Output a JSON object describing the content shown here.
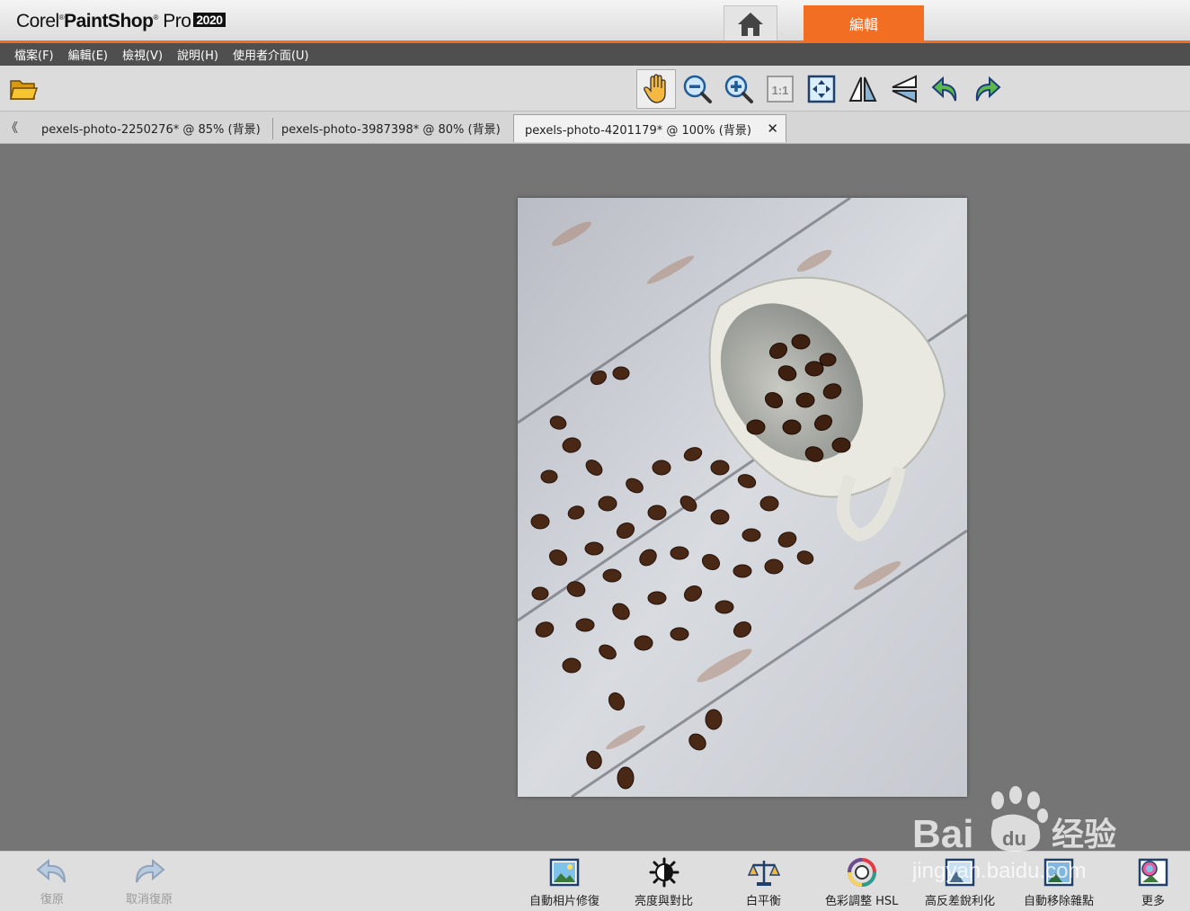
{
  "app": {
    "brand_corel": "Corel",
    "brand_paintshop": "PaintShop",
    "brand_pro": "Pro",
    "brand_version": "2020",
    "accent_color": "#f26e22"
  },
  "workspace_tabs": {
    "home_icon": "home-icon",
    "edit_label": "編輯"
  },
  "menu": [
    "檔案(F)",
    "編輯(E)",
    "檢視(V)",
    "說明(H)",
    "使用者介面(U)"
  ],
  "toolbar": {
    "tools": [
      "open-folder-icon",
      "pan-hand-icon",
      "zoom-out-icon",
      "zoom-in-icon",
      "actual-size-icon",
      "fit-window-icon",
      "flip-icon",
      "mirror-icon",
      "rotate-left-icon",
      "rotate-right-icon"
    ],
    "actual_size_label": "1:1"
  },
  "doc_tabs": [
    {
      "label": "pexels-photo-2250276* @  85% (背景)"
    },
    {
      "label": "pexels-photo-3987398* @  80% (背景)"
    },
    {
      "label": "pexels-photo-4201179* @ 100% (背景)",
      "active": true
    }
  ],
  "tab_scroll_glyph": "《",
  "tab_close_glyph": "✕",
  "bottom": {
    "undo": "復原",
    "redo": "取消復原",
    "tools": [
      "自動相片修復",
      "亮度與對比",
      "白平衡",
      "色彩調整 HSL",
      "高反差銳利化",
      "自動移除雜點",
      "更多"
    ]
  },
  "watermark": {
    "brand": "Bai",
    "du": "du",
    "jingyan": "经验",
    "url": "jingyan.baidu.com"
  }
}
